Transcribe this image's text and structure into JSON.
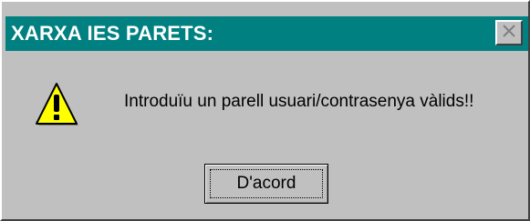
{
  "window": {
    "title": "XARXA IES PARETS:",
    "message": "Introduïu un parell usuari/contrasenya vàlids!!",
    "ok_label": "D'acord"
  },
  "icons": {
    "warning": "warning-icon",
    "close": "close-icon"
  },
  "colors": {
    "titlebar": "#008080",
    "background": "#c0c0c0",
    "warning_fill": "#ffff00"
  }
}
